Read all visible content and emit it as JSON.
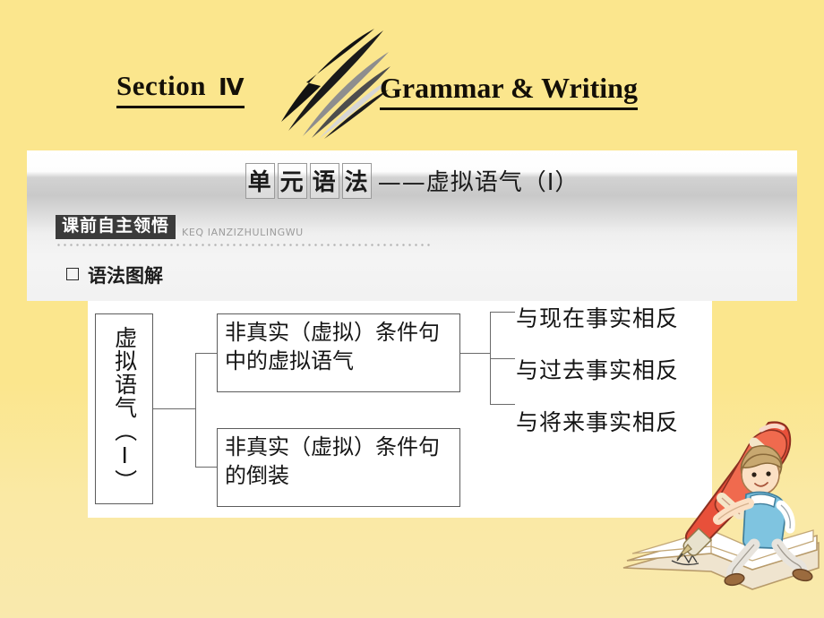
{
  "header": {
    "section_label": "Section",
    "section_numeral": "Ⅳ",
    "main_title": "Grammar & Writing",
    "swoosh_icon": "swoosh-arrow-icon"
  },
  "panel": {
    "unit_title_boxed_chars": [
      "单",
      "元",
      "语",
      "法"
    ],
    "unit_title_tail": "——虚拟语气（Ⅰ）",
    "ribbon_label": "课前自主领悟",
    "ribbon_pinyin": "KEQ IANZIZHULINGWU",
    "sub_heading": "语法图解",
    "bullet_icon": "square-bullet-icon"
  },
  "diagram": {
    "root": "虚拟语气（Ⅰ）",
    "branches": [
      {
        "label": "非真实（虚拟）条件句中的虚拟语气"
      },
      {
        "label": "非真实（虚拟）条件句的倒装"
      }
    ],
    "leaves": [
      "与现在事实相反",
      "与过去事实相反",
      "与将来事实相反"
    ]
  },
  "illustration": {
    "name": "boy-with-red-pen-on-book-illustration",
    "pen_color": "#e8503a",
    "book_color": "#ffffff",
    "shirt_color": "#7fc4e0",
    "hair_color": "#c8a870"
  },
  "colors": {
    "background": "#fbe68d",
    "panel_top": "#f2f2f2",
    "panel_diagram": "#ffffff",
    "ribbon_bg": "#3b3b3b",
    "text": "#161616",
    "line": "#6a6a6a"
  }
}
